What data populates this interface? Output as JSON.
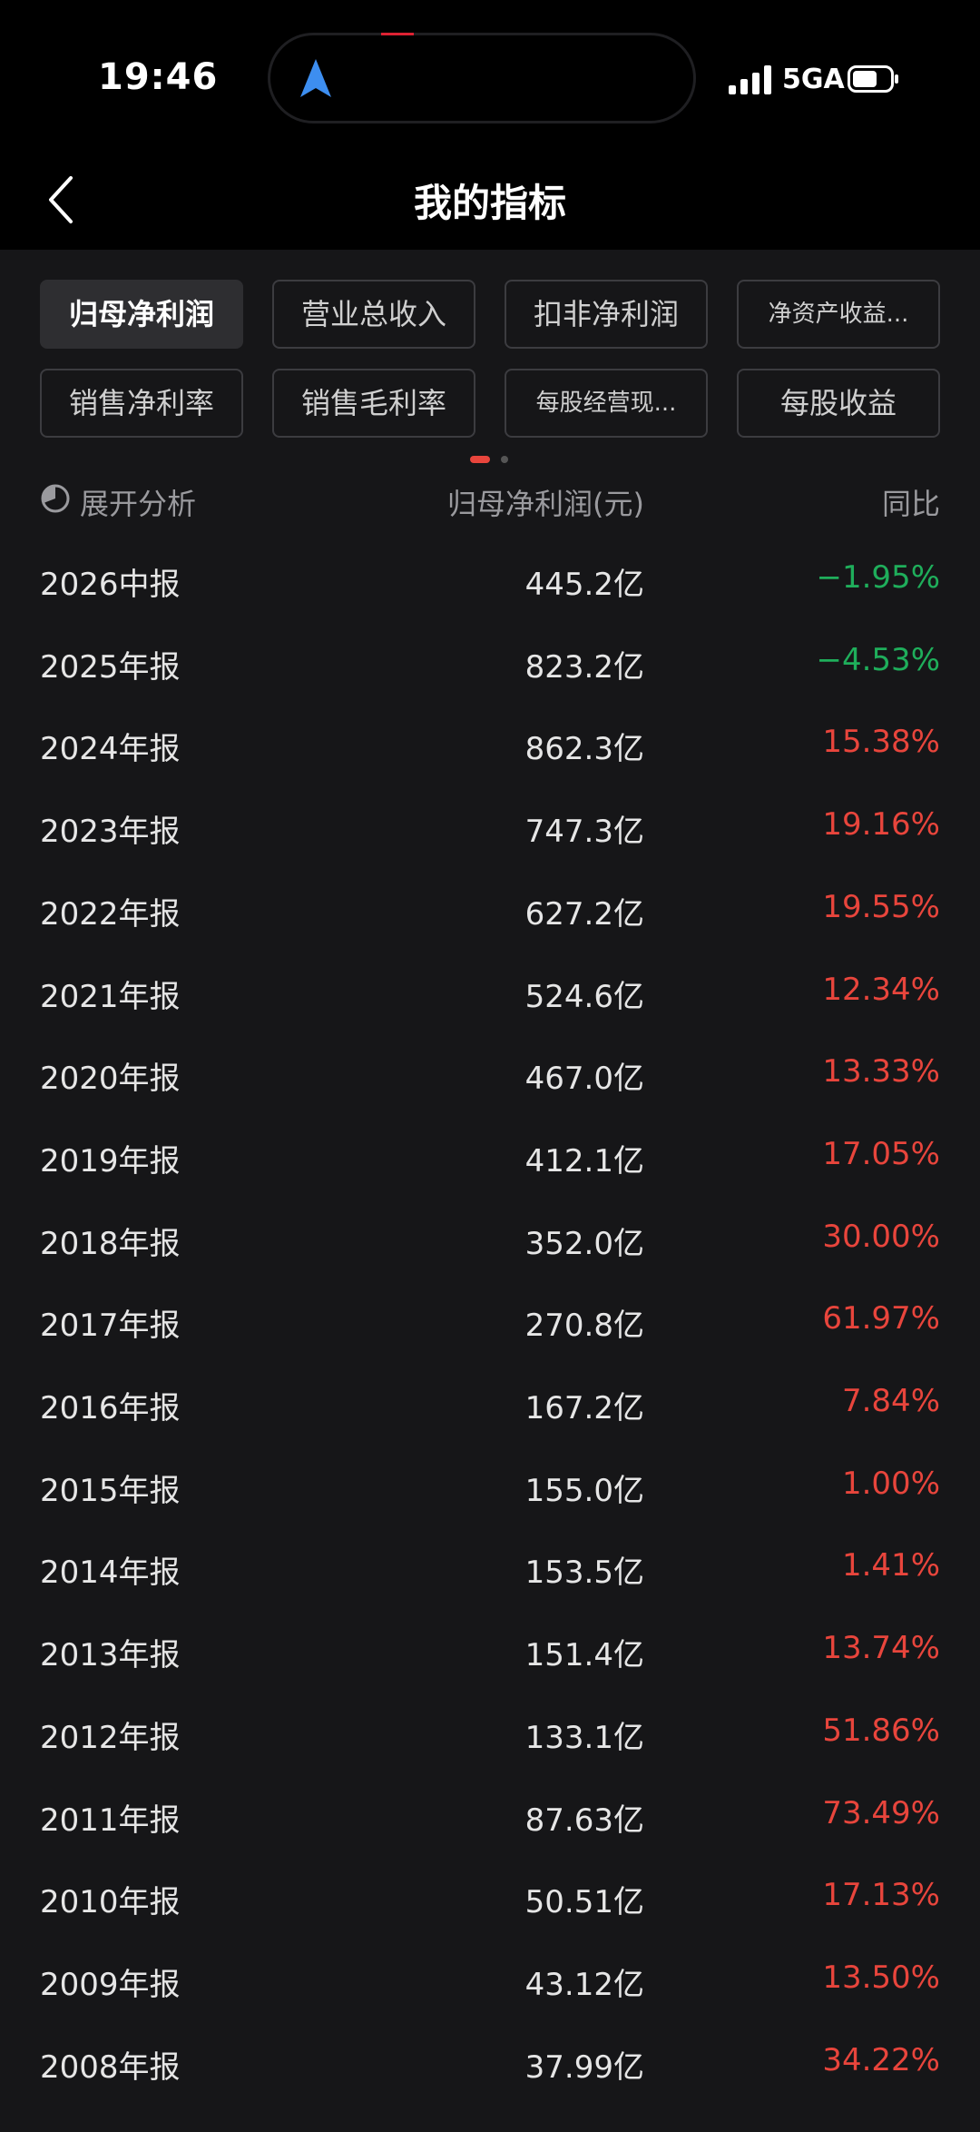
{
  "status_bar": {
    "time": "19:46",
    "network": "5GA",
    "signal_icon": "signal-bars-icon",
    "battery_icon": "battery-icon"
  },
  "header": {
    "title": "我的指标",
    "back_icon": "chevron-left-icon"
  },
  "chips": [
    {
      "label": "归母净利润",
      "active": true
    },
    {
      "label": "营业总收入",
      "active": false
    },
    {
      "label": "扣非净利润",
      "active": false
    },
    {
      "label": "净资产收益...",
      "active": false
    },
    {
      "label": "销售净利率",
      "active": false
    },
    {
      "label": "销售毛利率",
      "active": false
    },
    {
      "label": "每股经营现...",
      "active": false
    },
    {
      "label": "每股收益",
      "active": false
    }
  ],
  "table": {
    "headers": {
      "expand": "展开分析",
      "value": "归母净利润(元)",
      "yoy": "同比"
    },
    "rows": [
      {
        "period": "2026中报",
        "value": "445.2亿",
        "yoy": "−1.95%"
      },
      {
        "period": "2025年报",
        "value": "823.2亿",
        "yoy": "−4.53%"
      },
      {
        "period": "2024年报",
        "value": "862.3亿",
        "yoy": "15.38%"
      },
      {
        "period": "2023年报",
        "value": "747.3亿",
        "yoy": "19.16%"
      },
      {
        "period": "2022年报",
        "value": "627.2亿",
        "yoy": "19.55%"
      },
      {
        "period": "2021年报",
        "value": "524.6亿",
        "yoy": "12.34%"
      },
      {
        "period": "2020年报",
        "value": "467.0亿",
        "yoy": "13.33%"
      },
      {
        "period": "2019年报",
        "value": "412.1亿",
        "yoy": "17.05%"
      },
      {
        "period": "2018年报",
        "value": "352.0亿",
        "yoy": "30.00%"
      },
      {
        "period": "2017年报",
        "value": "270.8亿",
        "yoy": "61.97%"
      },
      {
        "period": "2016年报",
        "value": "167.2亿",
        "yoy": "7.84%"
      },
      {
        "period": "2015年报",
        "value": "155.0亿",
        "yoy": "1.00%"
      },
      {
        "period": "2014年报",
        "value": "153.5亿",
        "yoy": "1.41%"
      },
      {
        "period": "2013年报",
        "value": "151.4亿",
        "yoy": "13.74%"
      },
      {
        "period": "2012年报",
        "value": "133.1亿",
        "yoy": "51.86%"
      },
      {
        "period": "2011年报",
        "value": "87.63亿",
        "yoy": "73.49%"
      },
      {
        "period": "2010年报",
        "value": "50.51亿",
        "yoy": "17.13%"
      },
      {
        "period": "2009年报",
        "value": "43.12亿",
        "yoy": "13.50%"
      },
      {
        "period": "2008年报",
        "value": "37.99亿",
        "yoy": "34.22%"
      }
    ]
  },
  "colors": {
    "negative": "#1fae5b",
    "positive": "#e8453c",
    "active_dot": "#e8453c",
    "inactive_dot": "#555555"
  },
  "pager": {
    "page": 1,
    "total": 2
  }
}
